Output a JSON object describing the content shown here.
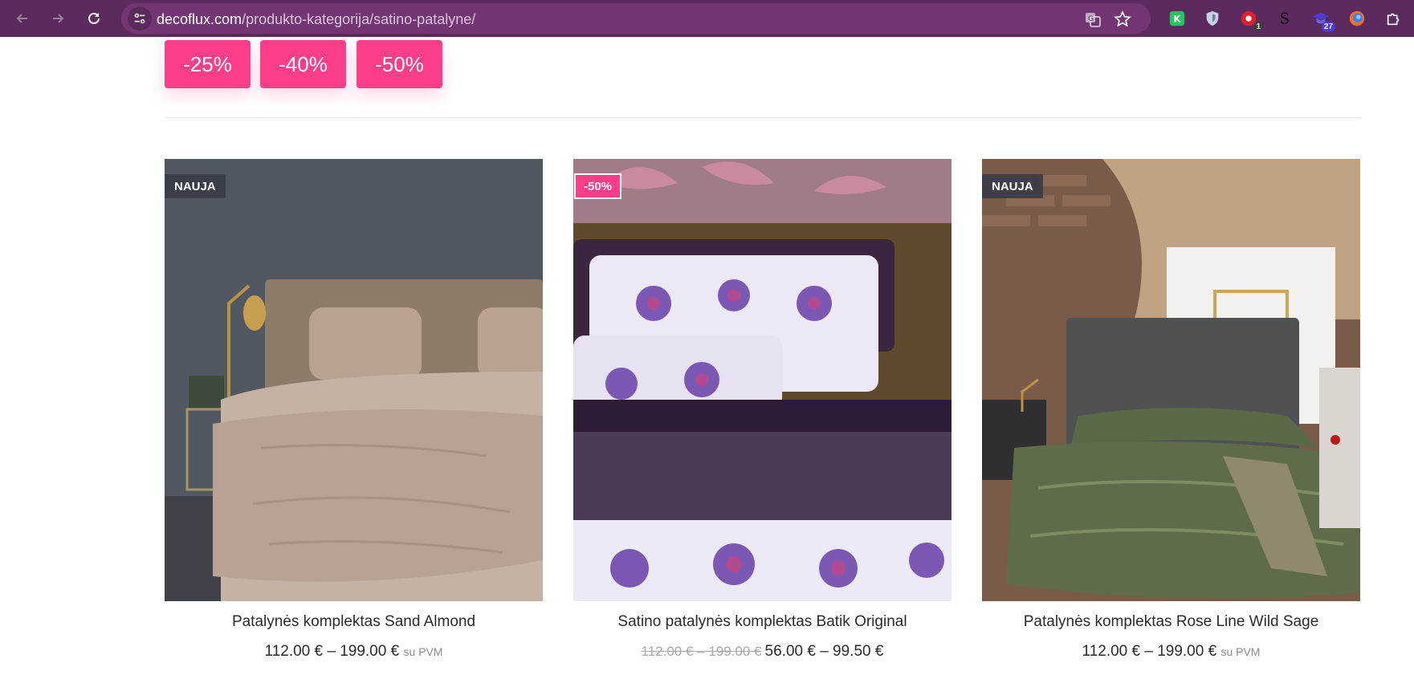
{
  "browser": {
    "url_domain": "decoflux.com",
    "url_path": "/produkto-kategorija/satino-patalyne/",
    "extensions": [
      {
        "name": "k-extension-icon",
        "badge": "",
        "color": "#22c55e"
      },
      {
        "name": "shield-extension-icon",
        "badge": "",
        "color": "#c7d2e8"
      },
      {
        "name": "red-extension-icon",
        "badge": "1",
        "color": "#e11d2e"
      },
      {
        "name": "s-extension-icon",
        "badge": "",
        "color": "#1a1a1a"
      },
      {
        "name": "graduation-cap-extension-icon",
        "badge": "27",
        "color": "#4b3bd6"
      },
      {
        "name": "firefox-relay-extension-icon",
        "badge": "",
        "color": "#f97316"
      },
      {
        "name": "puzzle-extensions-icon",
        "badge": "",
        "color": "#ffffff"
      }
    ]
  },
  "discounts": [
    "-25%",
    "-40%",
    "-50%"
  ],
  "colors": {
    "accent": "#ff3e8a",
    "chrome": "#5c2a5e",
    "tag_dark": "#373c48"
  },
  "products": [
    {
      "tag": "NAUJA",
      "title": "Patalynės komplektas Sand Almond",
      "price_range": "112.00 € – 199.00 €",
      "vat_note": "su PVM",
      "image": "beige-bedding-photo"
    },
    {
      "tag": "-50%",
      "title": "Satino patalynės komplektas Batik Original",
      "old_price": "112.00 € – 199.00 €",
      "price_range": "56.00 € – 99.50 €",
      "image": "batik-bedding-photo"
    },
    {
      "tag": "NAUJA",
      "title": "Patalynės komplektas Rose Line Wild Sage",
      "price_range": "112.00 € – 199.00 €",
      "vat_note": "su PVM",
      "image": "sage-bedding-photo"
    }
  ]
}
